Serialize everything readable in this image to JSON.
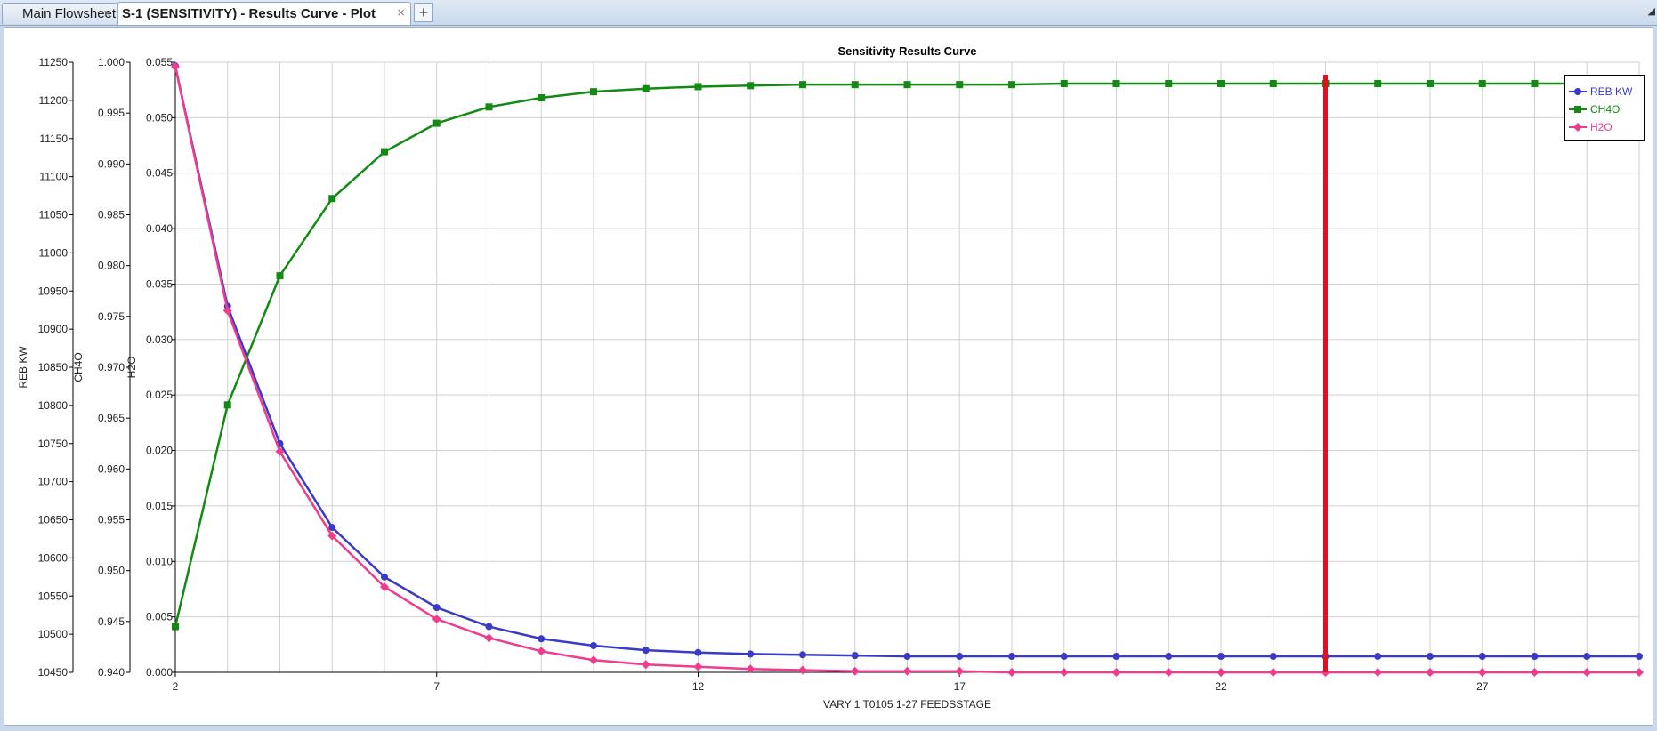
{
  "tabs": [
    {
      "label": "Main Flowsheet",
      "active": false
    },
    {
      "label": "S-1 (SENSITIVITY) - Results Curve - Plot",
      "active": true
    }
  ],
  "overflow_icon": "triangle-down-icon",
  "colors": {
    "reb_kw": "#3a3ac8",
    "ch4o": "#138a13",
    "h2o": "#f03c8c",
    "marker_line": "#e01020",
    "grid": "#d0d0d0"
  },
  "chart_data": {
    "type": "line",
    "title": "Sensitivity Results Curve",
    "xlabel": "VARY   1 T0105 1-27 FEEDSSTAGE",
    "xlim": [
      2,
      30
    ],
    "xticks": [
      "2",
      "7",
      "12",
      "17",
      "22",
      "27"
    ],
    "x": [
      2,
      3,
      4,
      5,
      6,
      7,
      8,
      9,
      10,
      11,
      12,
      13,
      14,
      15,
      16,
      17,
      18,
      19,
      20,
      21,
      22,
      23,
      24,
      25,
      26,
      27,
      28,
      29,
      30
    ],
    "axes": [
      {
        "label": "REB KW",
        "ylim": [
          10450,
          11250
        ],
        "ticks": [
          "11250",
          "11200",
          "11150",
          "11100",
          "11050",
          "11000",
          "10950",
          "10900",
          "10850",
          "10800",
          "10750",
          "10700",
          "10650",
          "10600",
          "10550",
          "10500",
          "10450"
        ]
      },
      {
        "label": "CH4O",
        "ylim": [
          0.94,
          1.0
        ],
        "ticks": [
          "1.000",
          "0.995",
          "0.990",
          "0.985",
          "0.980",
          "0.975",
          "0.970",
          "0.965",
          "0.960",
          "0.955",
          "0.950",
          "0.945",
          "0.940"
        ]
      },
      {
        "label": "H2O",
        "ylim": [
          0.0,
          0.055
        ],
        "ticks": [
          "0.055",
          "0.050",
          "0.045",
          "0.040",
          "0.035",
          "0.030",
          "0.025",
          "0.020",
          "0.015",
          "0.010",
          "0.005",
          "0.000"
        ]
      }
    ],
    "series": [
      {
        "name": "REB KW",
        "axis": 0,
        "marker": "circle",
        "values": [
          11245,
          10930,
          10750,
          10640,
          10575,
          10535,
          10510,
          10494,
          10485,
          10479,
          10476,
          10474,
          10473,
          10472,
          10471,
          10471,
          10471,
          10471,
          10471,
          10471,
          10471,
          10471,
          10471,
          10471,
          10471,
          10471,
          10471,
          10471,
          10471
        ]
      },
      {
        "name": "CH4O",
        "axis": 1,
        "marker": "square",
        "values": [
          0.9445,
          0.9663,
          0.979,
          0.9866,
          0.9912,
          0.994,
          0.9956,
          0.9965,
          0.9971,
          0.9974,
          0.9976,
          0.9977,
          0.9978,
          0.9978,
          0.9978,
          0.9978,
          0.9978,
          0.9979,
          0.9979,
          0.9979,
          0.9979,
          0.9979,
          0.9979,
          0.9979,
          0.9979,
          0.9979,
          0.9979,
          0.9979,
          0.9979
        ]
      },
      {
        "name": "H2O",
        "axis": 2,
        "marker": "diamond",
        "values": [
          0.0546,
          0.0326,
          0.0199,
          0.0123,
          0.0077,
          0.0048,
          0.0031,
          0.0019,
          0.0011,
          0.0007,
          0.0005,
          0.0003,
          0.0002,
          0.0001,
          0.0001,
          0.0001,
          0.0,
          0.0,
          0.0,
          0.0,
          0.0,
          0.0,
          0.0,
          0.0,
          0.0,
          0.0,
          0.0,
          0.0,
          0.0
        ]
      }
    ],
    "vertical_marker_x": 24,
    "grid": true,
    "legend_position": "top-right"
  }
}
